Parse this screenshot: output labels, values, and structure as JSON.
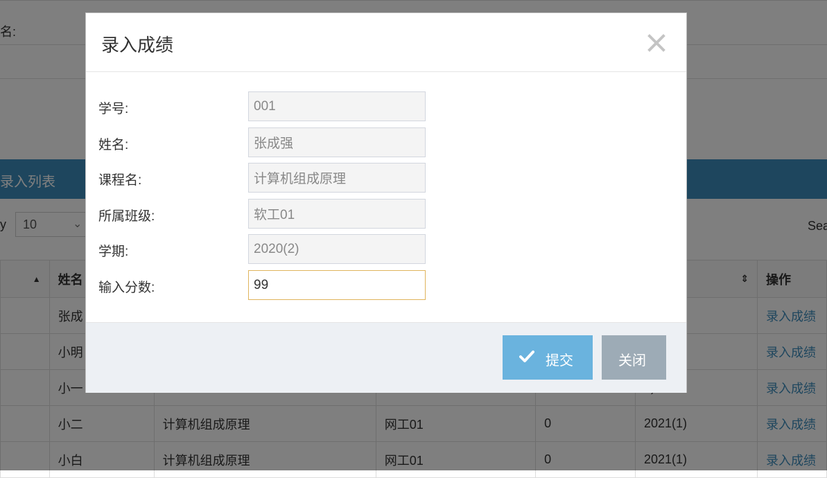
{
  "background": {
    "name_label": "名:",
    "list_header": "录入列表",
    "show_prefix": "y",
    "page_length": "10",
    "search_label": "Sea",
    "table": {
      "headers": [
        "",
        "姓名",
        "",
        "",
        "",
        "",
        "操作"
      ],
      "rows": [
        [
          "",
          "张成",
          "",
          "",
          "",
          "2)",
          "录入成绩"
        ],
        [
          "",
          "小明",
          "",
          "",
          "",
          "2)",
          "录入成绩"
        ],
        [
          "",
          "小一",
          "",
          "",
          "",
          "1)",
          "录入成绩"
        ],
        [
          "",
          "小二",
          "计算机组成原理",
          "网工01",
          "0",
          "2021(1)",
          "录入成绩"
        ],
        [
          "",
          "小白",
          "计算机组成原理",
          "网工01",
          "0",
          "2021(1)",
          "录入成绩"
        ]
      ]
    }
  },
  "modal": {
    "title": "录入成绩",
    "fields": [
      {
        "label": "学号:",
        "value": "001"
      },
      {
        "label": "姓名:",
        "value": "张成强"
      },
      {
        "label": "课程名:",
        "value": "计算机组成原理"
      },
      {
        "label": "所属班级:",
        "value": "软工01"
      },
      {
        "label": "学期:",
        "value": "2020(2)"
      },
      {
        "label": "输入分数:",
        "value": "99"
      }
    ],
    "submit_label": "提交",
    "close_label": "关闭"
  },
  "colors": {
    "header_blue": "#3c8dbc",
    "submit_button": "#6ab3de",
    "close_button": "#9dabb6",
    "active_input_border": "#e0b45c"
  }
}
